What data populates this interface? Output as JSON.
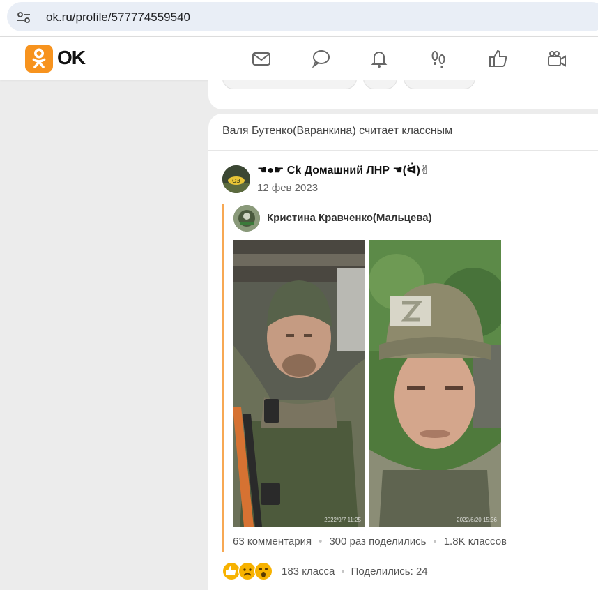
{
  "browser": {
    "url": "ok.ru/profile/577774559540"
  },
  "header": {
    "logo_text": "OK",
    "brand_color": "#f7931e",
    "nav": [
      "mail-icon",
      "chat-icon",
      "bell-icon",
      "guests-icon",
      "like-icon",
      "video-icon"
    ]
  },
  "feed": {
    "activity": "Валя Бутенко(Варанкина) считает классным",
    "post": {
      "group_name": "☚●☛ Ck Домашний ЛНР ☚(ᐛ)✌",
      "date": "12 фев 2023",
      "repost_author": "Кристина Кравченко(Мальцева)",
      "photos": [
        {
          "stamp": "2022/9/7 11:25"
        },
        {
          "stamp": "2022/6/20 15:36"
        }
      ],
      "stats": {
        "comments": "63 комментария",
        "shares": "300 раз поделились",
        "likes": "1.8K классов"
      },
      "reactions": {
        "icons": [
          "thumbs-up-icon",
          "sad-face-icon",
          "surprised-face-icon"
        ],
        "count": "183 класса",
        "shared": "Поделились: 24"
      }
    }
  }
}
